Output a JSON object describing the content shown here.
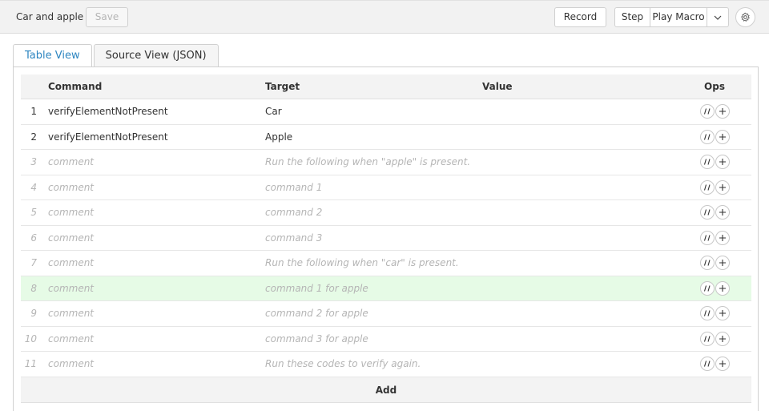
{
  "toolbar": {
    "macro_name": "Car and apple",
    "save_label": "Save",
    "record_label": "Record",
    "step_label": "Step",
    "play_label": "Play Macro"
  },
  "tabs": [
    {
      "label": "Table View",
      "active": true
    },
    {
      "label": "Source View (JSON)",
      "active": false
    }
  ],
  "table": {
    "headers": {
      "command": "Command",
      "target": "Target",
      "value": "Value",
      "ops": "Ops"
    },
    "rows": [
      {
        "index": "1",
        "command": "verifyElementNotPresent",
        "target": "Car",
        "value": "",
        "muted": false,
        "highlight": false
      },
      {
        "index": "2",
        "command": "verifyElementNotPresent",
        "target": "Apple",
        "value": "",
        "muted": false,
        "highlight": false
      },
      {
        "index": "3",
        "command": "comment",
        "target": "Run the following when \"apple\" is present.",
        "value": "",
        "muted": true,
        "highlight": false
      },
      {
        "index": "4",
        "command": "comment",
        "target": "command 1",
        "value": "",
        "muted": true,
        "highlight": false
      },
      {
        "index": "5",
        "command": "comment",
        "target": "command 2",
        "value": "",
        "muted": true,
        "highlight": false
      },
      {
        "index": "6",
        "command": "comment",
        "target": "command 3",
        "value": "",
        "muted": true,
        "highlight": false
      },
      {
        "index": "7",
        "command": "comment",
        "target": "Run the following when \"car\" is present.",
        "value": "",
        "muted": true,
        "highlight": false
      },
      {
        "index": "8",
        "command": "comment",
        "target": "command 1 for apple",
        "value": "",
        "muted": true,
        "highlight": true
      },
      {
        "index": "9",
        "command": "comment",
        "target": "command 2 for apple",
        "value": "",
        "muted": true,
        "highlight": false
      },
      {
        "index": "10",
        "command": "comment",
        "target": "command 3 for apple",
        "value": "",
        "muted": true,
        "highlight": false
      },
      {
        "index": "11",
        "command": "comment",
        "target": "Run these codes to verify again.",
        "value": "",
        "muted": true,
        "highlight": false
      }
    ],
    "add_label": "Add"
  },
  "icons": {
    "dropdown": "chevron-down-icon",
    "settings": "gear-icon",
    "comment_toggle": "comment-toggle-icon",
    "insert": "plus-icon"
  },
  "colors": {
    "active_tab": "#2e86c1",
    "highlight_row": "#e6fbe6",
    "muted_text": "#b5b5b5"
  }
}
